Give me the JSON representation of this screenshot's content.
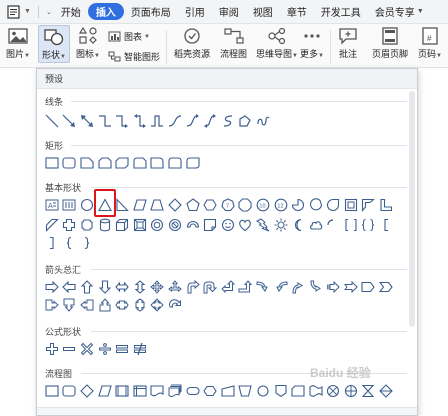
{
  "menubar": {
    "items": [
      "开始",
      "插入",
      "页面布局",
      "引用",
      "审阅",
      "视图",
      "章节",
      "开发工具",
      "会员专享"
    ],
    "active_index": 1,
    "accent": "#2f6fe0"
  },
  "ribbon": {
    "picture": "图片",
    "shapes": "形状",
    "icons": "图标",
    "chart": "图表",
    "smart_art": "智能图形",
    "docer_resource": "稻壳资源",
    "flowchart": "流程图",
    "mind_map": "思维导图",
    "more": "更多",
    "comment": "批注",
    "header_footer": "页眉页脚",
    "page_number": "页码"
  },
  "panel": {
    "preset": "预设",
    "sections": [
      {
        "id": "lines",
        "title": "线条"
      },
      {
        "id": "rectangles",
        "title": "矩形"
      },
      {
        "id": "basic",
        "title": "基本形状"
      },
      {
        "id": "arrows",
        "title": "箭头总汇"
      },
      {
        "id": "formula",
        "title": "公式形状"
      },
      {
        "id": "flowchart",
        "title": "流程图"
      }
    ],
    "highlight_color": "#e0151b"
  },
  "watermark": "Baidu 经验"
}
